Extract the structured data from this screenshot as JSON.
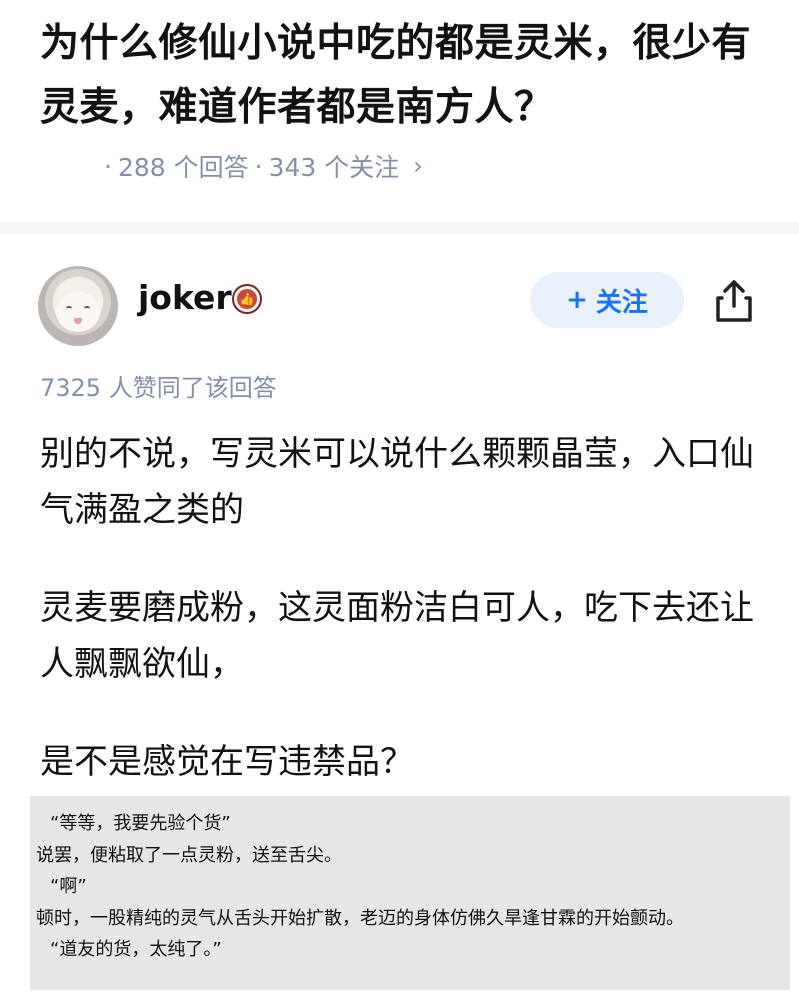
{
  "question": {
    "title": "为什么修仙小说中吃的都是灵米，很少有灵麦，难道作者都是南方人？",
    "answers": "288 个回答",
    "followers": "343 个关注"
  },
  "author": {
    "name": "joker",
    "follow_label": "关注",
    "follow_prefix": "+",
    "agree_text": "7325 人赞同了该回答"
  },
  "answer": {
    "paragraphs": [
      "别的不说，写灵米可以说什么颗颗晶莹，入口仙气满盈之类的",
      "灵麦要磨成粉，这灵面粉洁白可人，吃下去还让人飘飘欲仙，",
      "是不是感觉在写违禁品？"
    ],
    "quote_lines": [
      "“等等，我要先验个货”",
      "说罢，便粘取了一点灵粉，送至舌尖。",
      "“啊”",
      "顿时，一股精纯的灵气从舌头开始扩散，老迈的身体仿佛久旱逢甘霖的开始颤动。",
      "“道友的货，太纯了。”"
    ]
  },
  "icons": {
    "share": "share-icon",
    "chevron": "chevron-right-icon",
    "badge": "thumb-badge-icon"
  },
  "colors": {
    "accent": "#1772f6",
    "meta": "#8590a6",
    "follow_bg": "#e9f1fd",
    "quote_bg": "#e6e6e6"
  }
}
